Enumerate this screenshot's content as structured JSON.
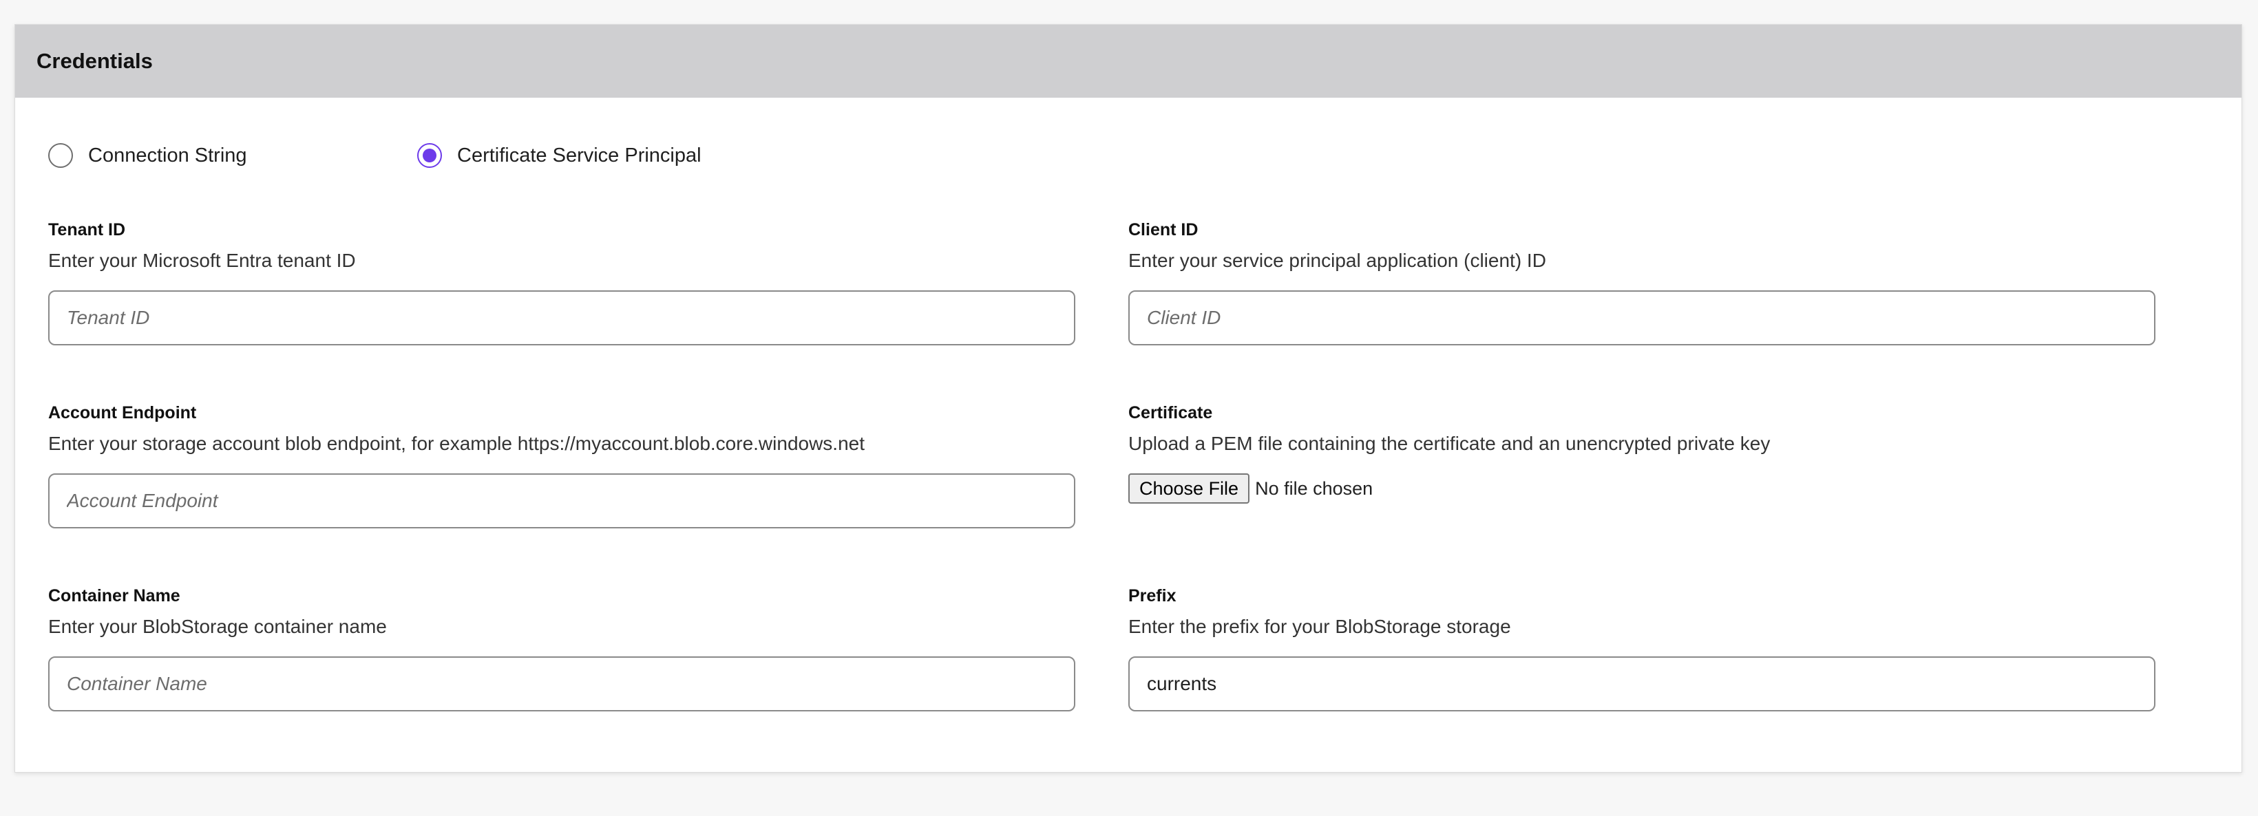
{
  "panel": {
    "title": "Credentials"
  },
  "auth_method": {
    "options": [
      {
        "label": "Connection String",
        "selected": false
      },
      {
        "label": "Certificate Service Principal",
        "selected": true
      }
    ],
    "accent_color": "#6d3bea"
  },
  "fields": {
    "tenant_id": {
      "label": "Tenant ID",
      "description": "Enter your Microsoft Entra tenant ID",
      "placeholder": "Tenant ID",
      "value": ""
    },
    "client_id": {
      "label": "Client ID",
      "description": "Enter your service principal application (client) ID",
      "placeholder": "Client ID",
      "value": ""
    },
    "account_endpoint": {
      "label": "Account Endpoint",
      "description": "Enter your storage account blob endpoint, for example https://myaccount.blob.core.windows.net",
      "placeholder": "Account Endpoint",
      "value": ""
    },
    "certificate": {
      "label": "Certificate",
      "description": "Upload a PEM file containing the certificate and an unencrypted private key",
      "button_label": "Choose File",
      "status": "No file chosen"
    },
    "container_name": {
      "label": "Container Name",
      "description": "Enter your BlobStorage container name",
      "placeholder": "Container Name",
      "value": ""
    },
    "prefix": {
      "label": "Prefix",
      "description": "Enter the prefix for your BlobStorage storage",
      "placeholder": "",
      "value": "currents"
    }
  }
}
